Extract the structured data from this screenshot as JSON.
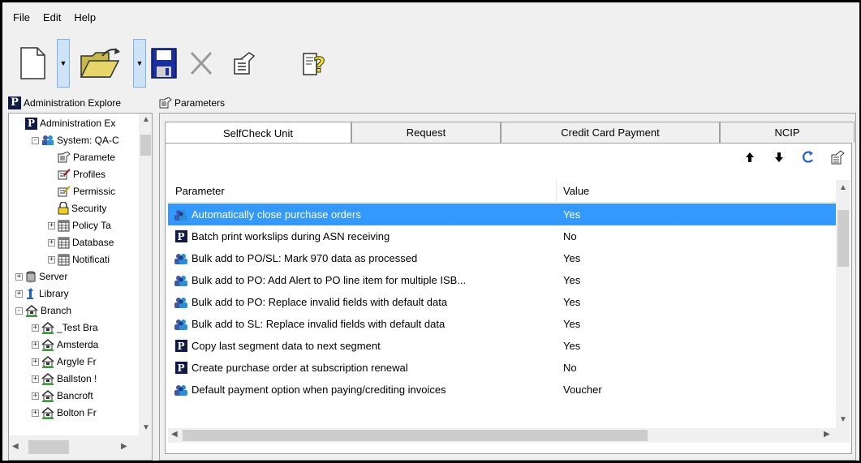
{
  "menu": [
    "File",
    "Edit",
    "Help"
  ],
  "toolbar": {
    "buttons": [
      "new-icon",
      "open-icon",
      "save-icon",
      "delete-icon",
      "properties-icon",
      "help-icon"
    ]
  },
  "left_panel": {
    "header": "Administration Explore",
    "tree": [
      {
        "label": "Administration Ex",
        "level": 0,
        "icon": "polaris-icon",
        "expander": ""
      },
      {
        "label": "System: QA-C",
        "level": 1,
        "icon": "system-icon",
        "expander": "-"
      },
      {
        "label": "Paramete",
        "level": 2,
        "icon": "parameters-icon",
        "expander": ""
      },
      {
        "label": "Profiles",
        "level": 2,
        "icon": "profiles-icon",
        "expander": ""
      },
      {
        "label": "Permissic",
        "level": 2,
        "icon": "permissions-icon",
        "expander": ""
      },
      {
        "label": "Security",
        "level": 2,
        "icon": "security-icon",
        "expander": ""
      },
      {
        "label": "Policy Ta",
        "level": 2,
        "icon": "table-icon",
        "expander": "+"
      },
      {
        "label": "Database",
        "level": 2,
        "icon": "table-icon",
        "expander": "+"
      },
      {
        "label": "Notificati",
        "level": 2,
        "icon": "table-icon",
        "expander": "+"
      },
      {
        "label": "Server",
        "level": 0,
        "icon": "server-icon",
        "expander": "+"
      },
      {
        "label": "Library",
        "level": 0,
        "icon": "library-icon",
        "expander": "+"
      },
      {
        "label": "Branch",
        "level": 0,
        "icon": "branch-icon",
        "expander": "-"
      },
      {
        "label": "_Test Bra",
        "level": 1,
        "icon": "branch-icon",
        "expander": "+"
      },
      {
        "label": "Amsterda",
        "level": 1,
        "icon": "branch-icon",
        "expander": "+"
      },
      {
        "label": "Argyle Fr",
        "level": 1,
        "icon": "branch-icon",
        "expander": "+"
      },
      {
        "label": "Ballston !",
        "level": 1,
        "icon": "branch-icon",
        "expander": "+"
      },
      {
        "label": "Bancroft",
        "level": 1,
        "icon": "branch-icon",
        "expander": "+"
      },
      {
        "label": "Bolton Fr",
        "level": 1,
        "icon": "branch-icon",
        "expander": "+"
      }
    ]
  },
  "right_panel": {
    "header": "Parameters",
    "tabs": [
      "SelfCheck Unit",
      "Request",
      "Credit Card Payment",
      "NCIP"
    ],
    "active_tab": 0,
    "tools": [
      "arrow-up-icon",
      "arrow-down-icon",
      "refresh-icon",
      "properties-icon"
    ],
    "grid": {
      "columns": [
        "Parameter",
        "Value"
      ],
      "rows": [
        {
          "icon": "users-icon",
          "parameter": "Automatically close purchase orders",
          "value": "Yes",
          "selected": true
        },
        {
          "icon": "polaris-icon",
          "parameter": "Batch print workslips during ASN receiving",
          "value": "No",
          "selected": false
        },
        {
          "icon": "users-icon",
          "parameter": "Bulk add to PO/SL: Mark 970 data as processed",
          "value": "Yes",
          "selected": false
        },
        {
          "icon": "users-icon",
          "parameter": "Bulk add to PO: Add Alert to PO line item for multiple ISB...",
          "value": "Yes",
          "selected": false
        },
        {
          "icon": "users-icon",
          "parameter": "Bulk add to PO: Replace invalid fields with default data",
          "value": "Yes",
          "selected": false
        },
        {
          "icon": "users-icon",
          "parameter": "Bulk add to SL: Replace invalid fields with default data",
          "value": "Yes",
          "selected": false
        },
        {
          "icon": "polaris-icon",
          "parameter": "Copy last segment data to next segment",
          "value": "Yes",
          "selected": false
        },
        {
          "icon": "polaris-icon",
          "parameter": "Create purchase order at subscription renewal",
          "value": "No",
          "selected": false
        },
        {
          "icon": "users-icon",
          "parameter": "Default payment option when paying/crediting invoices",
          "value": "Voucher",
          "selected": false
        }
      ]
    }
  },
  "colors": {
    "selection": "#3399ff",
    "polaris_badge": "#111a44",
    "window_bg": "#f0f0f0"
  }
}
